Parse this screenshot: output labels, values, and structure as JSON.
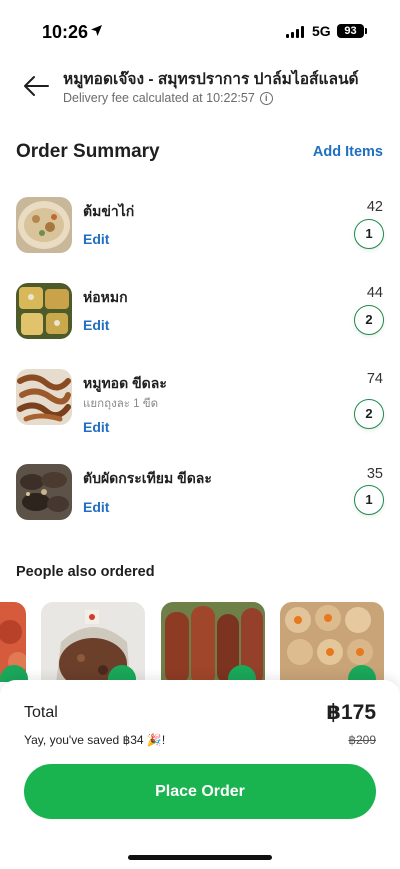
{
  "status_bar": {
    "time": "10:26",
    "network": "5G",
    "battery": "93"
  },
  "header": {
    "title": "หมูทอดเจ๊จง - สมุทรปราการ ปาล์มไอส์แลนด์",
    "delivery_note": "Delivery fee calculated at 10:22:57",
    "info_icon": "i"
  },
  "order_summary": {
    "title": "Order Summary",
    "add_items_label": "Add Items",
    "items": [
      {
        "name": "ต้มข่าไก่",
        "note": "",
        "edit_label": "Edit",
        "price": "42",
        "quantity": "1"
      },
      {
        "name": "ห่อหมก",
        "note": "",
        "edit_label": "Edit",
        "price": "44",
        "quantity": "2"
      },
      {
        "name": "หมูทอด ขีดละ",
        "note": "แยกถุงละ 1 ขีด",
        "edit_label": "Edit",
        "price": "74",
        "quantity": "2"
      },
      {
        "name": "ตับผัดกระเทียม ขีดละ",
        "note": "",
        "edit_label": "Edit",
        "price": "35",
        "quantity": "1"
      }
    ]
  },
  "recommendations": {
    "title": "People also ordered"
  },
  "summary": {
    "total_label": "Total",
    "total_value": "฿175",
    "savings_text": "Yay, you've saved ฿34 🎉!",
    "original_price": "฿209",
    "place_order_label": "Place Order"
  },
  "colors": {
    "accent_blue": "#1f6fc2",
    "brand_green": "#19b44f",
    "qty_border": "#1a8a4a"
  }
}
